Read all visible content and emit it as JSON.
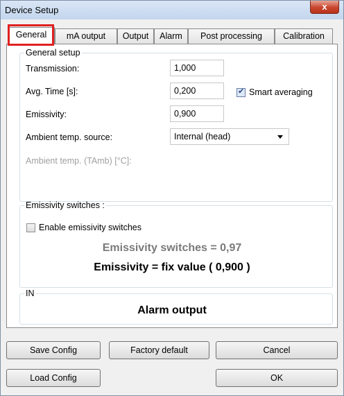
{
  "window": {
    "title": "Device Setup",
    "close_label": "x"
  },
  "tabs": [
    {
      "label": "General"
    },
    {
      "label": "mA output"
    },
    {
      "label": "Output"
    },
    {
      "label": "Alarm"
    },
    {
      "label": "Post processing"
    },
    {
      "label": "Calibration"
    }
  ],
  "general_setup": {
    "legend": "General setup",
    "transmission": {
      "label": "Transmission:",
      "value": "1,000"
    },
    "avg_time": {
      "label": "Avg. Time [s]:",
      "value": "0,200"
    },
    "smart_averaging": {
      "label": "Smart averaging",
      "checked": true
    },
    "emissivity": {
      "label": "Emissivity:",
      "value": "0,900"
    },
    "ambient_source": {
      "label": "Ambient temp. source:",
      "value": "Internal (head)"
    },
    "ambient_temp": {
      "label": "Ambient temp. (TAmb) [°C]:"
    }
  },
  "emissivity_switches": {
    "legend": "Emissivity switches :",
    "enable_label": "Enable emissivity switches",
    "enabled": false,
    "switches_text": "Emissivity switches = 0,97",
    "fix_value_text": "Emissivity = fix value ( 0,900 )"
  },
  "in_group": {
    "legend": "IN",
    "text": "Alarm output"
  },
  "buttons": {
    "save_config": "Save Config",
    "factory_default": "Factory default",
    "cancel": "Cancel",
    "load_config": "Load Config",
    "ok": "OK"
  }
}
